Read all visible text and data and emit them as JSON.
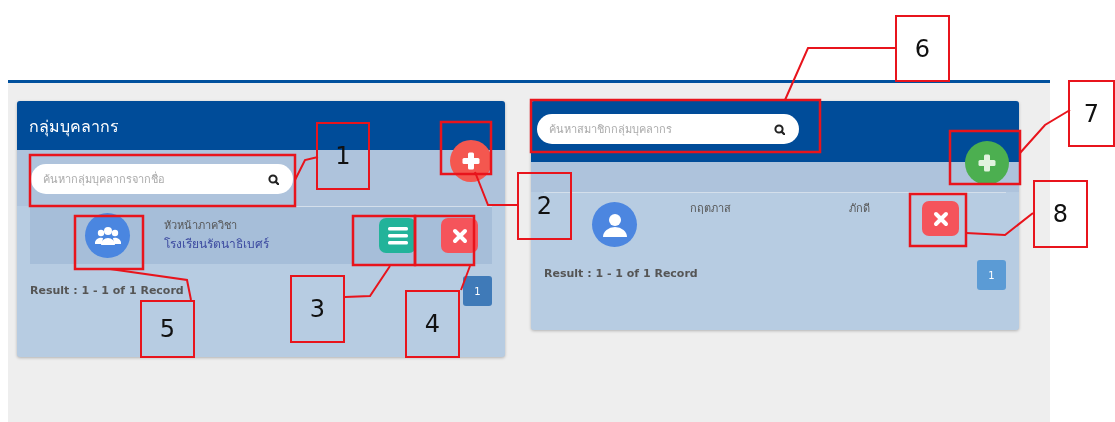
{
  "left_panel": {
    "title": "กลุ่มบุคลากร",
    "search": {
      "placeholder": "ค้นหากลุ่มบุคลากรจากชื่อ"
    },
    "rows": [
      {
        "line_1": "หัวหน้าภาควิชา",
        "line_2": "โรงเรียนรัตนาธิเบศร์"
      }
    ],
    "result": "Result : 1 - 1 of 1 Record",
    "pages": [
      {
        "label": "1",
        "selected": true
      }
    ]
  },
  "right_panel": {
    "search": {
      "placeholder": "ค้นหาสมาชิกกลุ่มบุคลากร"
    },
    "rows": [
      {
        "first_name": "กฤตภาส",
        "last_name": "ภักดี"
      }
    ],
    "result": "Result : 1 - 1 of 1 Record",
    "pages": [
      {
        "label": "1",
        "selected": true
      }
    ]
  },
  "annotations": [
    {
      "label": "1"
    },
    {
      "label": "2"
    },
    {
      "label": "3"
    },
    {
      "label": "4"
    },
    {
      "label": "5"
    },
    {
      "label": "6"
    },
    {
      "label": "7"
    },
    {
      "label": "8"
    }
  ]
}
